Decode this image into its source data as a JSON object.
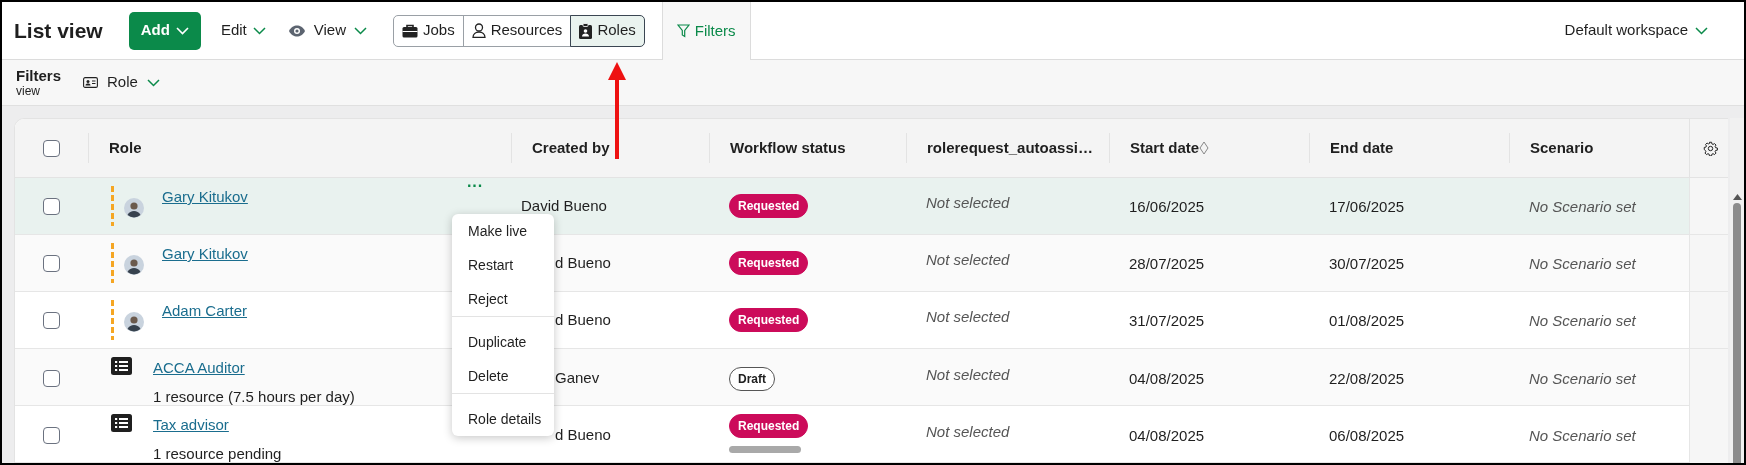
{
  "header": {
    "title": "List view",
    "add_button": "Add",
    "edit_menu": "Edit",
    "view_menu": "View",
    "entity_tabs": [
      {
        "kind": "jobs",
        "label": "Jobs",
        "selected": false
      },
      {
        "kind": "resources",
        "label": "Resources",
        "selected": false
      },
      {
        "kind": "roles",
        "label": "Roles",
        "selected": true
      }
    ],
    "filters_tab": {
      "label": "Filters",
      "selected": true
    },
    "workspace": "Default workspace"
  },
  "filter_bar": {
    "title": "Filters",
    "subtitle": "view",
    "role_filter": "Role"
  },
  "table": {
    "select_all": {
      "checked": false
    },
    "columns": [
      {
        "label": "Role",
        "sortable": false
      },
      {
        "label": "Created by",
        "sortable": false
      },
      {
        "label": "Workflow status",
        "sortable": false
      },
      {
        "label": "rolerequest_autoassi…",
        "sortable": false
      },
      {
        "label": "Start date",
        "sortable": true
      },
      {
        "label": "End date",
        "sortable": false
      },
      {
        "label": "Scenario",
        "sortable": false
      }
    ],
    "rows": [
      {
        "checked": false,
        "highlighted": true,
        "kind": "person",
        "pending_marker": true,
        "name": "Gary Kitukov",
        "created_by": "David Bueno",
        "partly_hidden": false,
        "status": {
          "kind": "requested",
          "label": "Requested"
        },
        "extra_bar": false,
        "autoassign": "Not selected",
        "start": "16/06/2025",
        "end": "17/06/2025",
        "scenario": "No Scenario set",
        "menu_button": "···"
      },
      {
        "checked": false,
        "highlighted": false,
        "kind": "person",
        "pending_marker": true,
        "name": "Gary Kitukov",
        "created_by": "d Bueno",
        "partly_hidden": true,
        "status": {
          "kind": "requested",
          "label": "Requested"
        },
        "extra_bar": false,
        "autoassign": "Not selected",
        "start": "28/07/2025",
        "end": "30/07/2025",
        "scenario": "No Scenario set"
      },
      {
        "checked": false,
        "highlighted": false,
        "kind": "person",
        "pending_marker": true,
        "name": "Adam Carter",
        "created_by": "d Bueno",
        "partly_hidden": true,
        "status": {
          "kind": "requested",
          "label": "Requested"
        },
        "extra_bar": false,
        "autoassign": "Not selected",
        "start": "31/07/2025",
        "end": "01/08/2025",
        "scenario": "No Scenario set"
      },
      {
        "checked": false,
        "highlighted": false,
        "kind": "job",
        "pending_marker": false,
        "name": "ACCA Auditor",
        "detail": "1 resource (7.5 hours per day)",
        "created_by": "Ganev",
        "partly_hidden": true,
        "status": {
          "kind": "draft",
          "label": "Draft"
        },
        "extra_bar": false,
        "autoassign": "Not selected",
        "start": "04/08/2025",
        "end": "22/08/2025",
        "scenario": "No Scenario set"
      },
      {
        "checked": false,
        "highlighted": false,
        "kind": "job",
        "pending_marker": false,
        "name": "Tax advisor",
        "detail": "1 resource pending",
        "created_by": "d Bueno",
        "partly_hidden": true,
        "status": {
          "kind": "requested",
          "label": "Requested"
        },
        "extra_bar": true,
        "autoassign": "Not selected",
        "start": "04/08/2025",
        "end": "06/08/2025",
        "scenario": "No Scenario set"
      }
    ]
  },
  "row_menu": {
    "items": [
      {
        "label": "Make live",
        "divider_before": false
      },
      {
        "label": "Restart",
        "divider_before": false
      },
      {
        "label": "Reject",
        "divider_before": false
      },
      {
        "label": "Duplicate",
        "divider_before": true
      },
      {
        "label": "Delete",
        "divider_before": false
      },
      {
        "label": "Role details",
        "divider_before": true
      }
    ]
  },
  "annotation_arrow": true
}
